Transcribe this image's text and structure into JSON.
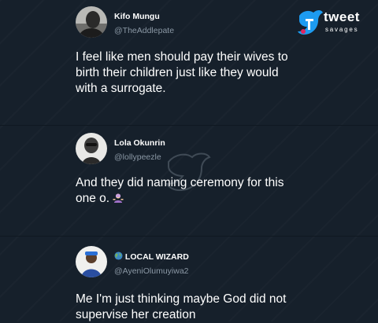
{
  "branding": {
    "logo_word": "tweet",
    "logo_sub": "savages"
  },
  "tweets": [
    {
      "name": "Kifo Mungu",
      "handle": "@TheAddlepate",
      "text_lines": [
        "I feel like men should pay their wives to",
        "birth their children just like they would",
        "with a surrogate."
      ]
    },
    {
      "name": "Lola Okunrin",
      "handle": "@lollypeezle",
      "text_lines": [
        "And they did naming ceremony for this",
        "one o."
      ],
      "emoji_icon": "woman-shrugging-icon"
    },
    {
      "name": "LOCAL WIZARD",
      "name_icon": "globe-icon",
      "handle": "@AyeniOlumuyiwa2",
      "text_lines": [
        "Me I'm just thinking maybe God did not",
        "supervise her creation"
      ]
    }
  ],
  "colors": {
    "background": "#16202b",
    "text": "#ffffff",
    "handle": "#8b98a5",
    "logo_blue": "#1d9bf0",
    "logo_red": "#e0245e"
  }
}
